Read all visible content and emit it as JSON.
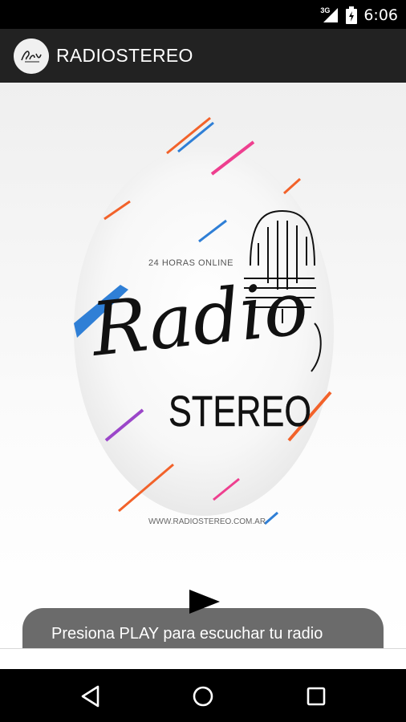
{
  "status_bar": {
    "network": "3G",
    "time": "6:06"
  },
  "app_bar": {
    "title": "RADIOSTEREO"
  },
  "logo": {
    "tagline": "24 HORAS ONLINE",
    "word1": "Radio",
    "word2": "STEREO",
    "url": "WWW.RADIOSTEREO.COM.AR"
  },
  "toast": {
    "message": "Presiona PLAY para escuchar tu radio preferida."
  },
  "colors": {
    "accent_blue": "#2f7fd6",
    "accent_orange": "#f2622a",
    "accent_pink": "#ee3f8f",
    "accent_purple": "#9b46c9"
  },
  "icons": {
    "play": "play-icon",
    "back": "back-icon",
    "home": "home-icon",
    "recents": "recents-icon"
  }
}
